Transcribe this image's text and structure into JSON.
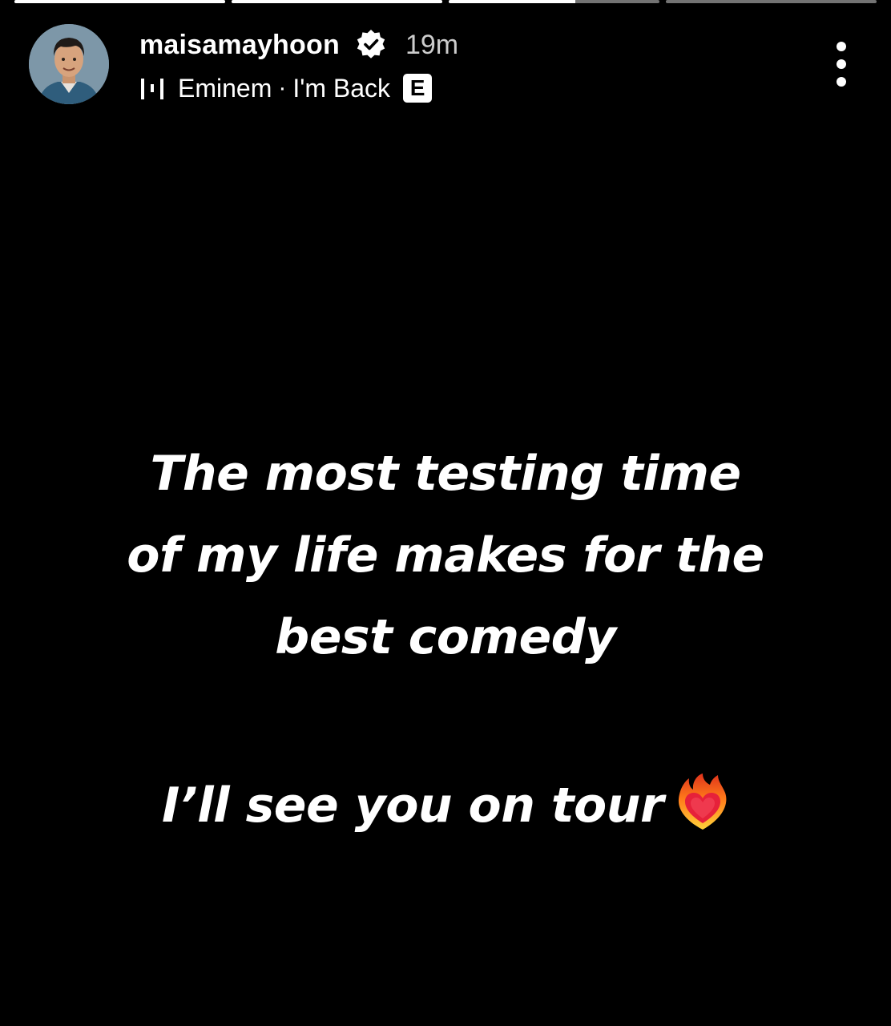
{
  "story": {
    "progress_segments": [
      1,
      1,
      0.6,
      0
    ],
    "username": "maisamayhoon",
    "time_ago": "19m",
    "verified": true,
    "music": {
      "icon": "music-bars-icon",
      "artist": "Eminem",
      "separator": "·",
      "song": "I'm Back",
      "explicit_label": "E"
    },
    "more_icon": "more-vertical-icon",
    "text": {
      "line1": "The most testing time",
      "line2": "of my life makes for the",
      "line3": "best comedy",
      "line4": "I’ll see you on tour"
    },
    "emoji": "heart-on-fire-icon"
  },
  "colors": {
    "background": "#000000",
    "text": "#ffffff"
  }
}
